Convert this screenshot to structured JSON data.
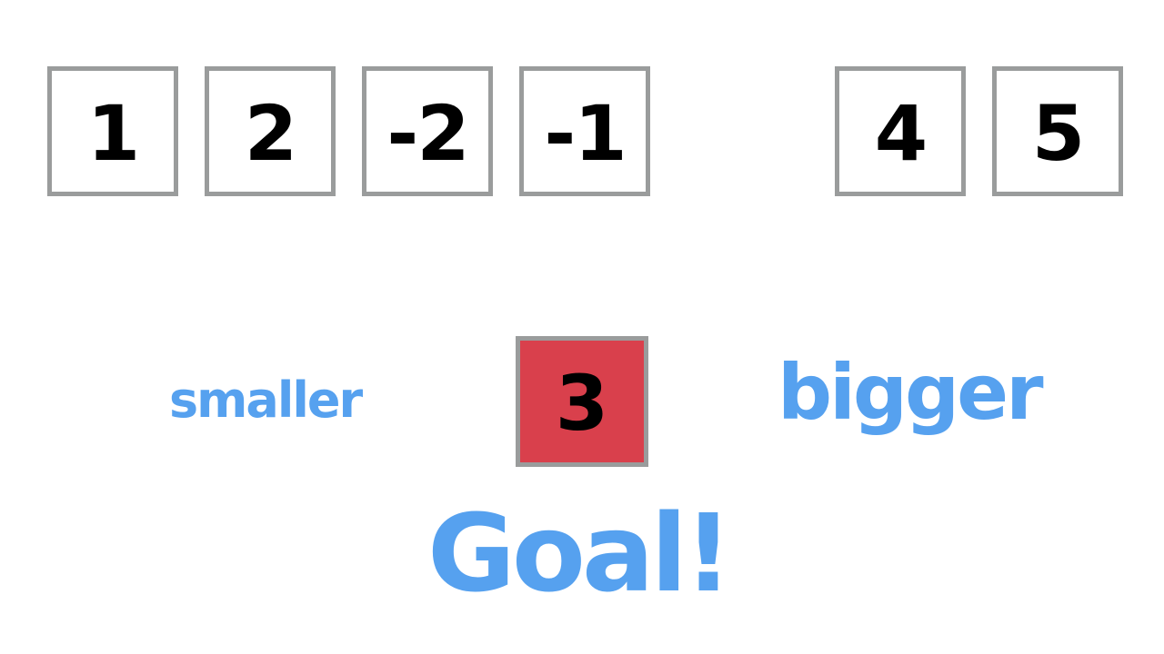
{
  "colors": {
    "label_blue": "#56a1ef",
    "pivot_red": "#d9404c",
    "cell_border": "#9a9c9c",
    "cell_text": "#000000"
  },
  "array": {
    "cells": [
      "1",
      "2",
      "-2",
      "-1",
      "4",
      "5"
    ]
  },
  "pivot": {
    "value": "3"
  },
  "labels": {
    "smaller": "smaller",
    "bigger": "bigger",
    "goal": "Goal!"
  }
}
